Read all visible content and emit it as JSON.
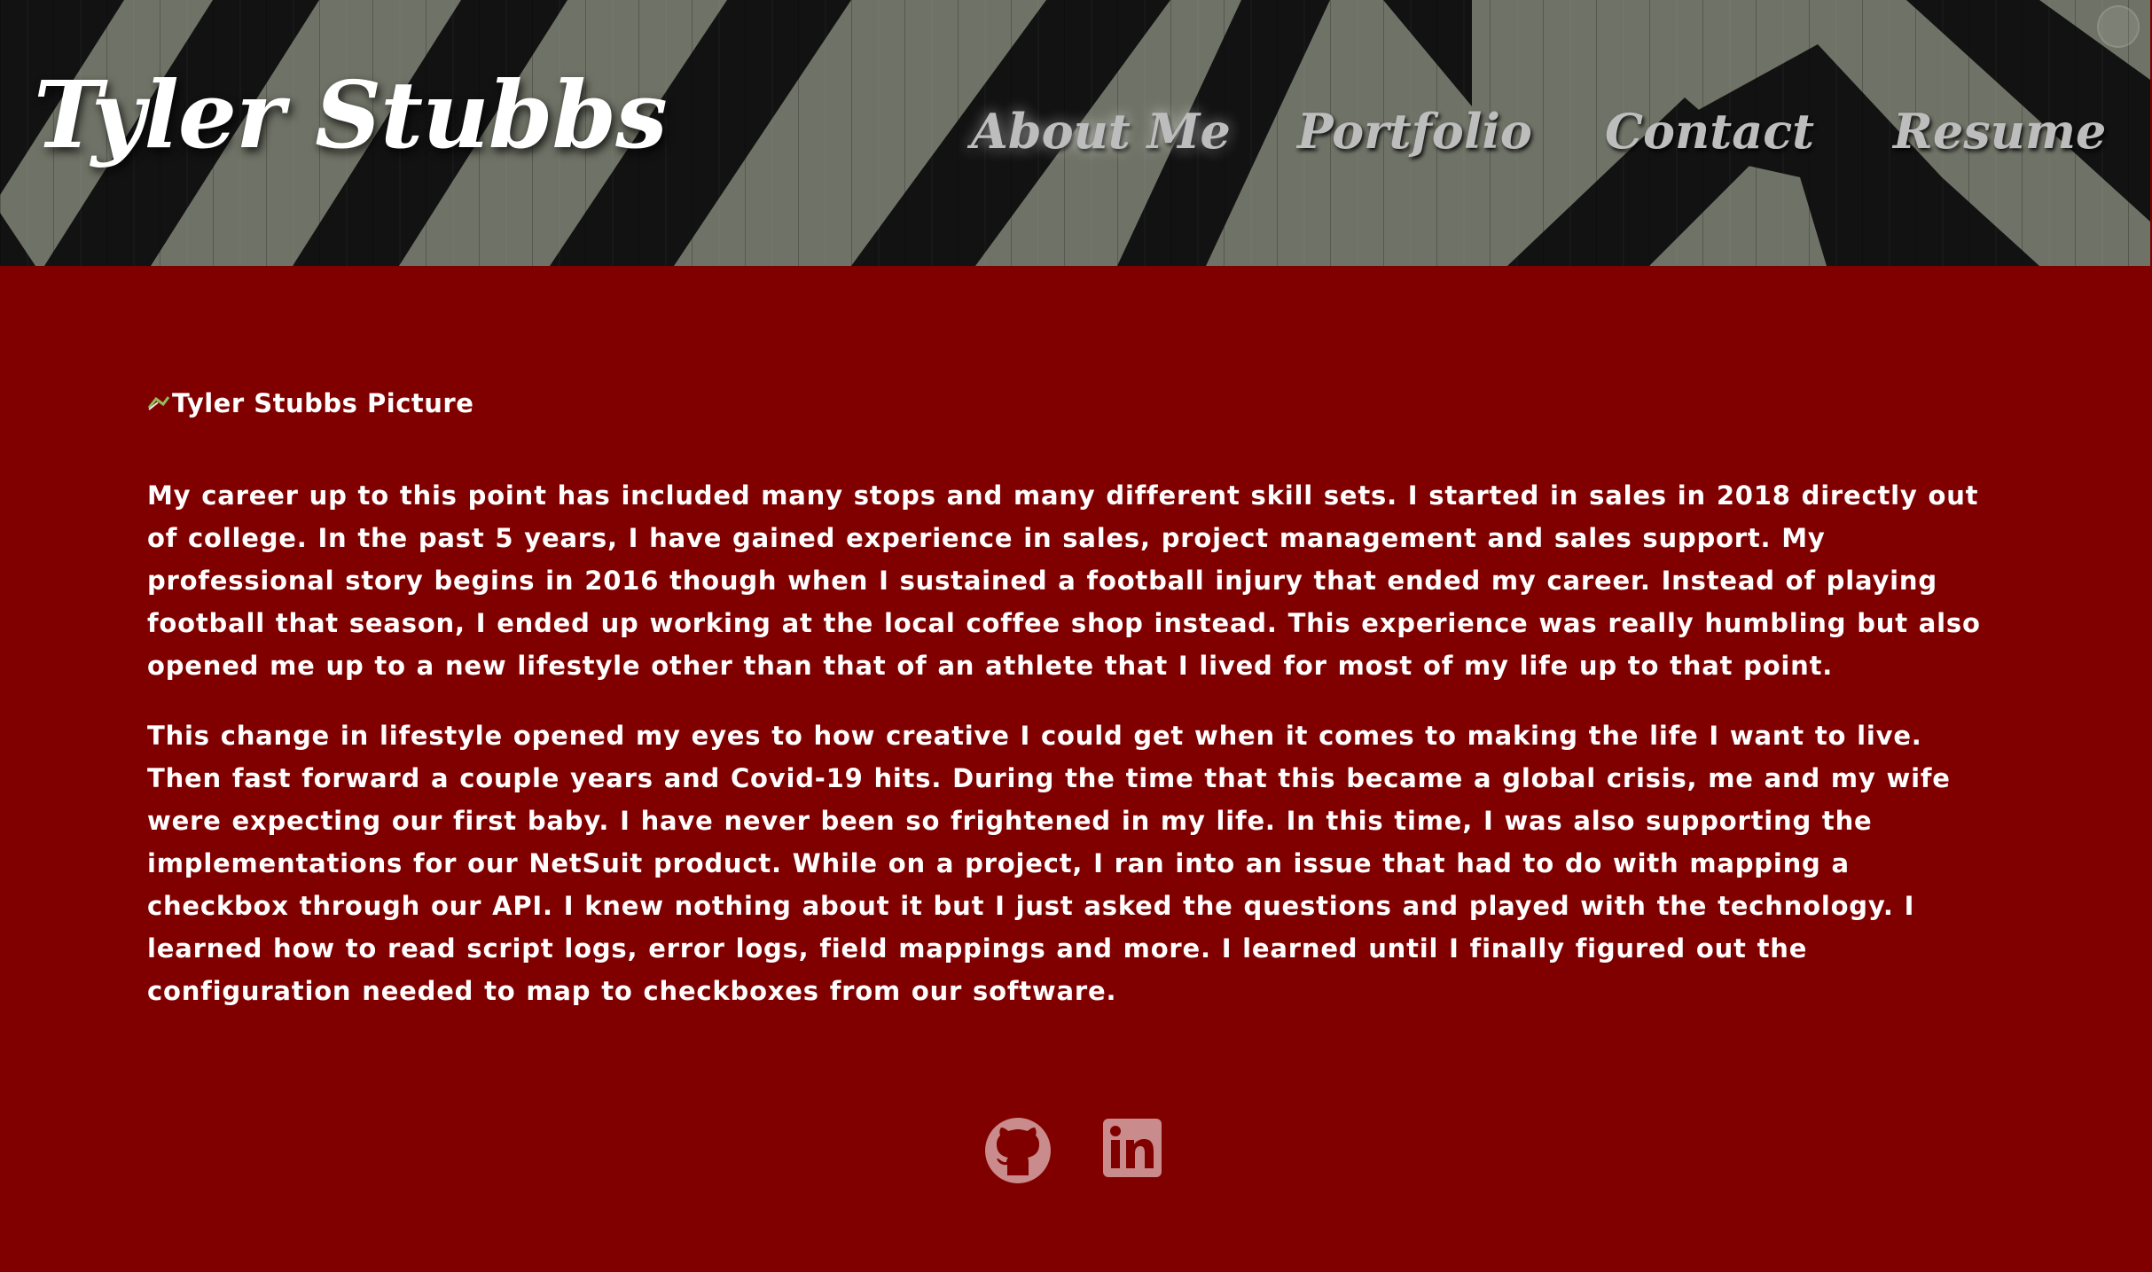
{
  "header": {
    "brand": "Tyler Stubbs",
    "nav": [
      {
        "label": "About Me",
        "active": true
      },
      {
        "label": "Portfolio"
      },
      {
        "label": "Contact"
      },
      {
        "label": "Resume"
      }
    ],
    "background_colors": {
      "light": "#6f7266",
      "dark": "#121212"
    }
  },
  "main": {
    "profile_image_alt": "Tyler Stubbs Picture",
    "paragraphs": [
      "My career up to this point has included many stops and many different skill sets. I started in sales in 2018 directly out of college. In the past 5 years, I have gained experience in sales, project management and sales support. My professional story begins in 2016 though when I sustained a football injury that ended my career. Instead of playing football that season, I ended up working at the local coffee shop instead. This experience was really humbling but also opened me up to a new lifestyle other than that of an athlete that I lived for most of my life up to that point.",
      "This change in lifestyle opened my eyes to how creative I could get when it comes to making the life I want to live. Then fast forward a couple years and Covid-19 hits. During the time that this became a global crisis, me and my wife were expecting our first baby. I have never been so frightened in my life. In this time, I was also supporting the implementations for our NetSuit product. While on a project, I ran into an issue that had to do with mapping a checkbox through our API. I knew nothing about it but I just asked the questions and played with the technology. I learned how to read script logs, error logs, field mappings and more. I learned until I finally figured out the configuration needed to map to checkboxes from our software."
    ]
  },
  "social": [
    {
      "icon": "github-icon"
    },
    {
      "icon": "linkedin-icon"
    }
  ],
  "colors": {
    "page_background": "#800000",
    "text": "#ffffff",
    "nav_text": "#bdbdbd",
    "social_icon": "#c98b8b"
  }
}
